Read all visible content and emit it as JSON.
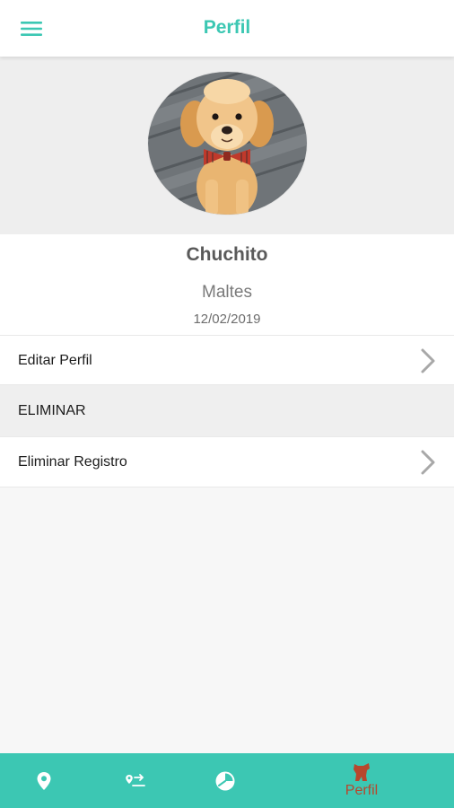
{
  "app_bar": {
    "title": "Perfil",
    "menu_icon": "hamburger-menu-icon"
  },
  "profile": {
    "photo_alt": "golden retriever puppy with bow tie",
    "name": "Chuchito",
    "breed": "Maltes",
    "date": "12/02/2019"
  },
  "menu": {
    "edit_profile_label": "Editar Perfil",
    "section_header": "ELIMINAR",
    "delete_record_label": "Eliminar Registro"
  },
  "bottom_nav": {
    "items": [
      {
        "icon": "location-pin-icon",
        "label": ""
      },
      {
        "icon": "route-icon",
        "label": ""
      },
      {
        "icon": "clock-pie-icon",
        "label": ""
      },
      {
        "icon": "dog-icon",
        "label": "Perfil",
        "active": true
      }
    ]
  },
  "colors": {
    "accent": "#3cc7b3",
    "active_nav": "#b7472d",
    "background": "#f7f7f7"
  }
}
